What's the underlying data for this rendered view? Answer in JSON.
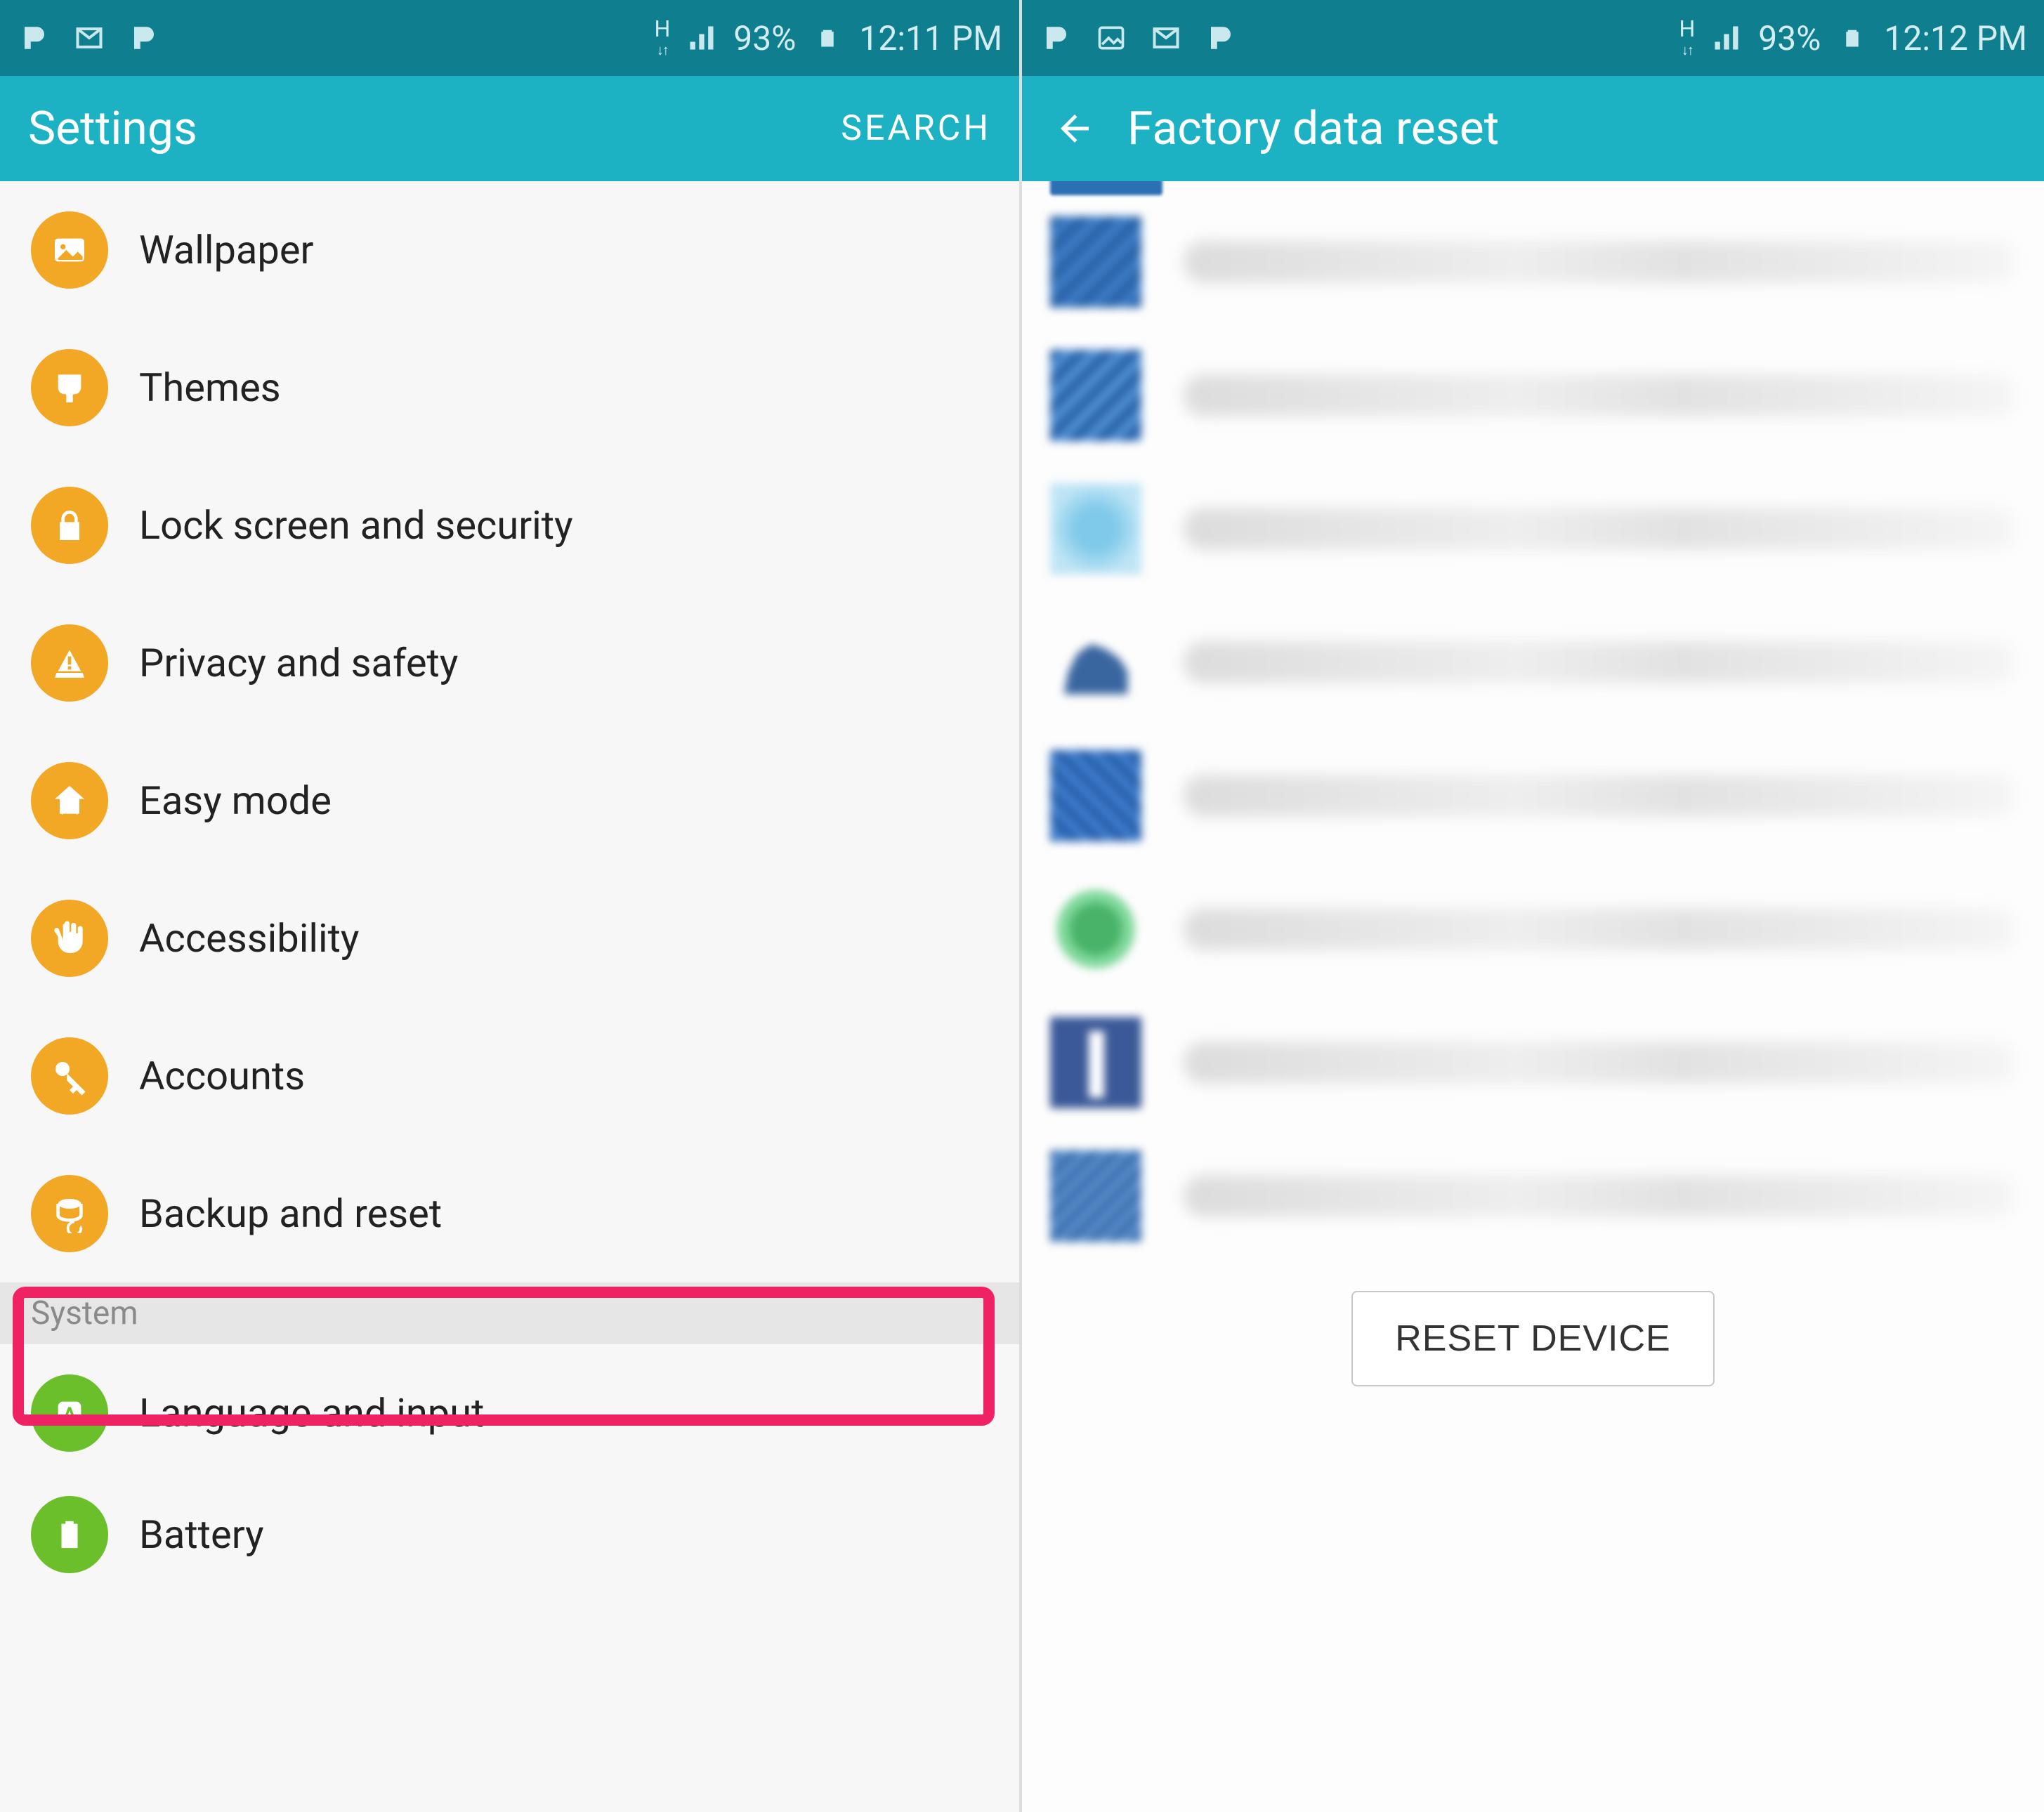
{
  "left": {
    "status": {
      "battery": "93%",
      "time": "12:11 PM",
      "net_label": "H"
    },
    "appbar": {
      "title": "Settings",
      "search": "SEARCH"
    },
    "items": [
      {
        "label": "Wallpaper",
        "icon": "picture-icon",
        "color": "orange"
      },
      {
        "label": "Themes",
        "icon": "brush-icon",
        "color": "orange"
      },
      {
        "label": "Lock screen and security",
        "icon": "lock-icon",
        "color": "orange"
      },
      {
        "label": "Privacy and safety",
        "icon": "warning-icon",
        "color": "orange"
      },
      {
        "label": "Easy mode",
        "icon": "home-icon",
        "color": "orange"
      },
      {
        "label": "Accessibility",
        "icon": "hand-icon",
        "color": "orange"
      },
      {
        "label": "Accounts",
        "icon": "key-icon",
        "color": "orange"
      },
      {
        "label": "Backup and reset",
        "icon": "backup-icon",
        "color": "orange",
        "highlighted": true
      }
    ],
    "section_header": "System",
    "system_items": [
      {
        "label": "Language and input",
        "icon": "language-icon",
        "color": "green"
      },
      {
        "label": "Battery",
        "icon": "battery-icon",
        "color": "green"
      }
    ]
  },
  "right": {
    "status": {
      "battery": "93%",
      "time": "12:12 PM",
      "net_label": "H"
    },
    "appbar": {
      "title": "Factory data reset"
    },
    "accounts_count": 8,
    "reset_button": "RESET DEVICE"
  }
}
